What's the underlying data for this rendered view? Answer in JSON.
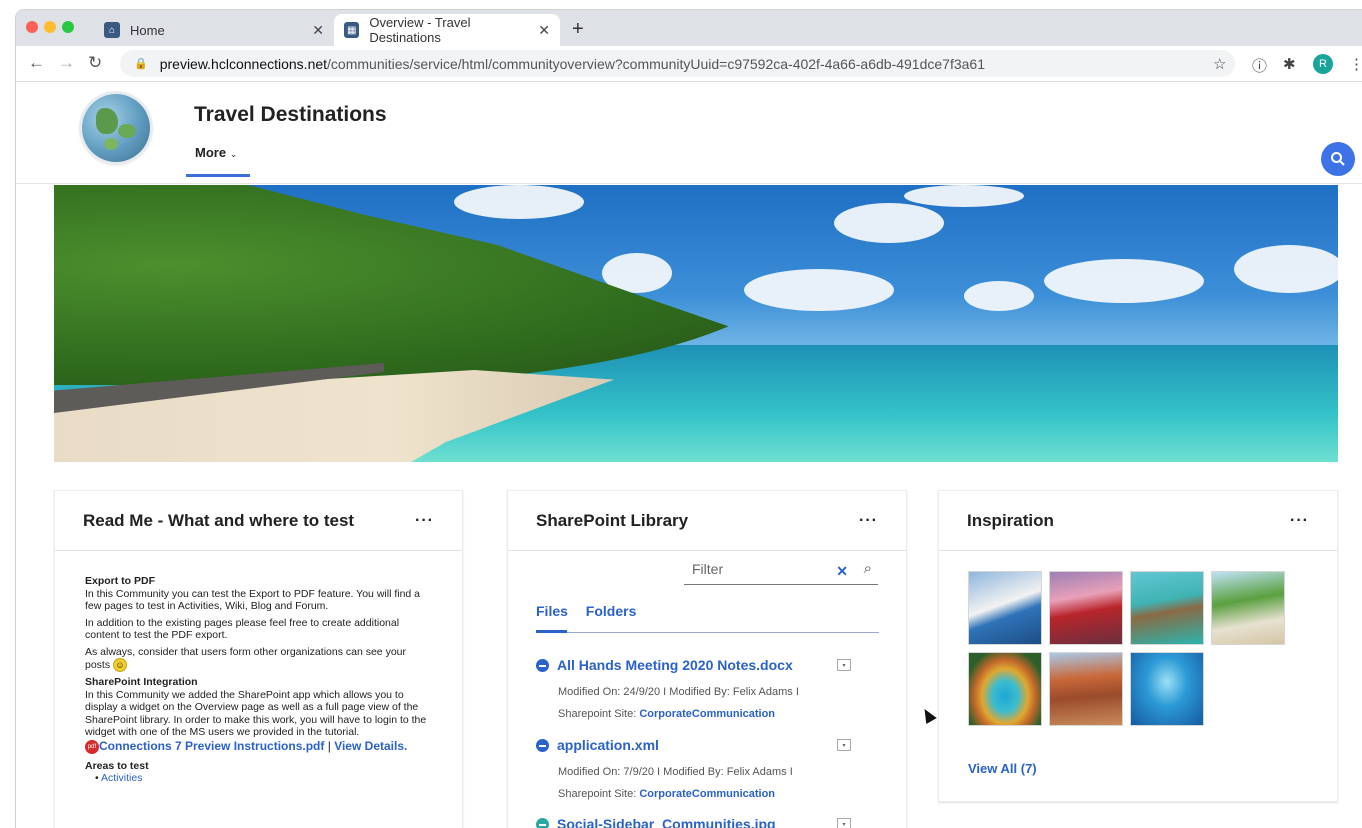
{
  "browser": {
    "tabs": [
      {
        "label": "Home",
        "close": "✕"
      },
      {
        "label": "Overview - Travel Destinations",
        "close": "✕"
      }
    ],
    "new_tab": "+",
    "url_host": "preview.hclconnections.net",
    "url_path": "/communities/service/html/communityoverview?communityUuid=c97592ca-402f-4a66-a6db-491dce7f3a61",
    "profile_initial": "R"
  },
  "community": {
    "title": "Travel Destinations",
    "more_label": "More"
  },
  "readme": {
    "title": "Read Me - What and where to test",
    "menu": "···",
    "export_heading": "Export to PDF",
    "export_p1": "In this Community you can test the Export to PDF feature. You will find a few pages to test in Activities, Wiki, Blog and Forum.",
    "export_p2": "In addition to the existing pages please feel free to create additional content to test the PDF export.",
    "export_p3": "As always, consider that users form other organizations can see your posts",
    "sp_heading": "SharePoint Integration",
    "sp_p1": "In this Community we added the SharePoint app which allows you to display a widget on the Overview page as well as a full page view of the SharePoint library. In order to make this work, you will have to login to the widget with one of the MS users we provided in the tutorial.",
    "pdf_link": "Connections 7 Preview Instructions.pdf",
    "separator": "|",
    "view_details": "View Details.",
    "areas_heading": "Areas to test",
    "areas_item1": "Activities"
  },
  "sharepoint": {
    "title": "SharePoint Library",
    "menu": "···",
    "filter_placeholder": "Filter",
    "tab_files": "Files",
    "tab_folders": "Folders",
    "files": [
      {
        "name": "All Hands Meeting 2020 Notes.docx",
        "meta1": "Modified On: 24/9/20 I Modified By: Felix Adams I",
        "site_label": "Sharepoint Site:",
        "site": "CorporateCommunication"
      },
      {
        "name": "application.xml",
        "meta1": "Modified On: 7/9/20 I Modified By: Felix Adams I",
        "site_label": "Sharepoint Site:",
        "site": "CorporateCommunication"
      },
      {
        "name": "Social-Sidebar_Communities.jpg"
      }
    ]
  },
  "inspiration": {
    "title": "Inspiration",
    "menu": "···",
    "view_all": "View All (7)",
    "thumbs": [
      "santorini",
      "pagoda",
      "overwater-bungalows",
      "palm-beach",
      "hot-spring",
      "florence",
      "underwater"
    ]
  }
}
